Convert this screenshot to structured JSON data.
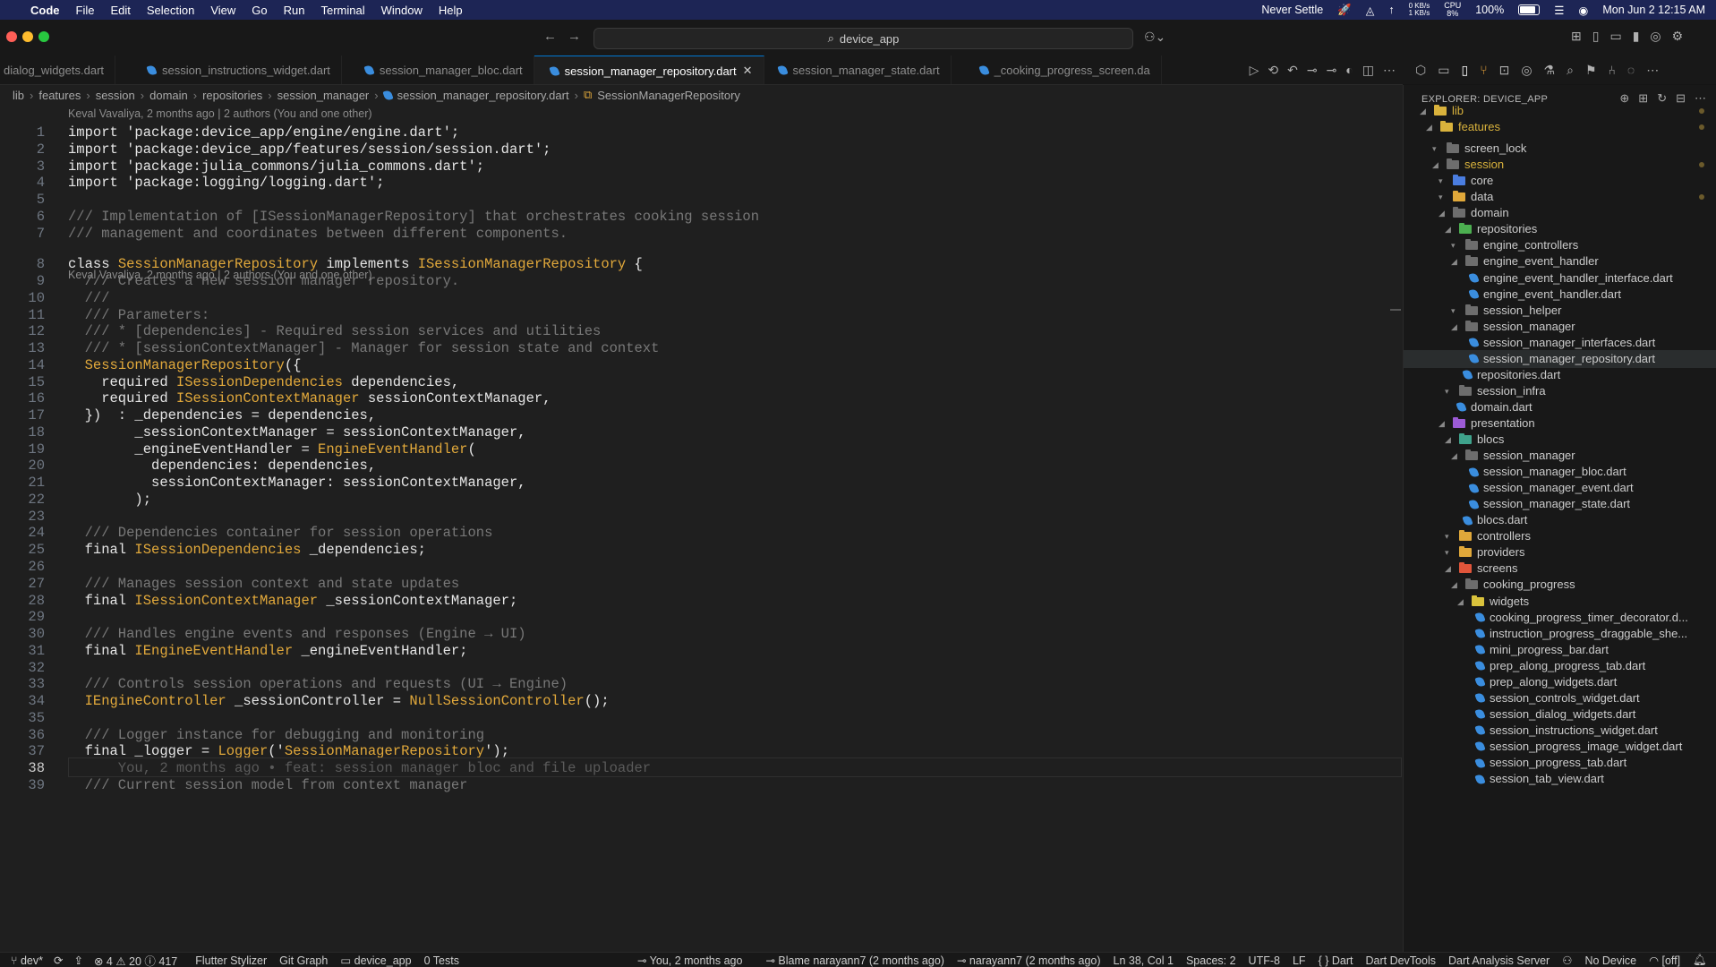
{
  "menubar": {
    "app": "Code",
    "items": [
      "File",
      "Edit",
      "Selection",
      "View",
      "Go",
      "Run",
      "Terminal",
      "Window",
      "Help"
    ],
    "never_settle": "Never Settle",
    "net_up": "0 KB/s",
    "net_down": "1 KB/s",
    "cpu_label": "CPU",
    "cpu_value": "8%",
    "battery": "100%",
    "datetime": "Mon Jun 2  12:15 AM"
  },
  "titlebar": {
    "search": "device_app"
  },
  "tabs": [
    {
      "label": "dialog_widgets.dart",
      "active": false
    },
    {
      "label": "session_instructions_widget.dart",
      "active": false
    },
    {
      "label": "session_manager_bloc.dart",
      "active": false
    },
    {
      "label": "session_manager_repository.dart",
      "active": true
    },
    {
      "label": "session_manager_state.dart",
      "active": false
    },
    {
      "label": "_cooking_progress_screen.da",
      "active": false
    }
  ],
  "breadcrumb": [
    "lib",
    "features",
    "session",
    "domain",
    "repositories",
    "session_manager",
    "session_manager_repository.dart",
    "SessionManagerRepository"
  ],
  "blame": {
    "top": "Keval Vavaliya, 2 months ago | 2 authors (You and one other)",
    "class": "Keval Vavaliya, 2 months ago | 2 authors (You and one other)"
  },
  "code_lines": [
    {
      "n": "1",
      "t": "import 'package:device_app/engine/engine.dart';"
    },
    {
      "n": "2",
      "t": "import 'package:device_app/features/session/session.dart';"
    },
    {
      "n": "3",
      "t": "import 'package:julia_commons/julia_commons.dart';"
    },
    {
      "n": "4",
      "t": "import 'package:logging/logging.dart';"
    },
    {
      "n": "5",
      "t": ""
    },
    {
      "n": "6",
      "t": "/// Implementation of [ISessionManagerRepository] that orchestrates cooking session"
    },
    {
      "n": "7",
      "t": "/// management and coordinates between different components."
    },
    {
      "n": "8",
      "t": "class SessionManagerRepository implements ISessionManagerRepository {"
    },
    {
      "n": "9",
      "t": "  /// Creates a new session manager repository."
    },
    {
      "n": "10",
      "t": "  ///"
    },
    {
      "n": "11",
      "t": "  /// Parameters:"
    },
    {
      "n": "12",
      "t": "  /// * [dependencies] - Required session services and utilities"
    },
    {
      "n": "13",
      "t": "  /// * [sessionContextManager] - Manager for session state and context"
    },
    {
      "n": "14",
      "t": "  SessionManagerRepository({"
    },
    {
      "n": "15",
      "t": "    required ISessionDependencies dependencies,"
    },
    {
      "n": "16",
      "t": "    required ISessionContextManager sessionContextManager,"
    },
    {
      "n": "17",
      "t": "  })  : _dependencies = dependencies,"
    },
    {
      "n": "18",
      "t": "        _sessionContextManager = sessionContextManager,"
    },
    {
      "n": "19",
      "t": "        _engineEventHandler = EngineEventHandler("
    },
    {
      "n": "20",
      "t": "          dependencies: dependencies,"
    },
    {
      "n": "21",
      "t": "          sessionContextManager: sessionContextManager,"
    },
    {
      "n": "22",
      "t": "        );"
    },
    {
      "n": "23",
      "t": ""
    },
    {
      "n": "24",
      "t": "  /// Dependencies container for session operations"
    },
    {
      "n": "25",
      "t": "  final ISessionDependencies _dependencies;"
    },
    {
      "n": "26",
      "t": ""
    },
    {
      "n": "27",
      "t": "  /// Manages session context and state updates"
    },
    {
      "n": "28",
      "t": "  final ISessionContextManager _sessionContextManager;"
    },
    {
      "n": "29",
      "t": ""
    },
    {
      "n": "30",
      "t": "  /// Handles engine events and responses (Engine → UI)"
    },
    {
      "n": "31",
      "t": "  final IEngineEventHandler _engineEventHandler;"
    },
    {
      "n": "32",
      "t": ""
    },
    {
      "n": "33",
      "t": "  /// Controls session operations and requests (UI → Engine)"
    },
    {
      "n": "34",
      "t": "  IEngineController _sessionController = NullSessionController();"
    },
    {
      "n": "35",
      "t": ""
    },
    {
      "n": "36",
      "t": "  /// Logger instance for debugging and monitoring"
    },
    {
      "n": "37",
      "t": "  final _logger = Logger('SessionManagerRepository');"
    },
    {
      "n": "38",
      "t": "      You, 2 months ago • feat: session manager bloc and file uploader"
    },
    {
      "n": "39",
      "t": "  /// Current session model from context manager"
    }
  ],
  "explorer": {
    "title": "EXPLORER: DEVICE_APP",
    "items": [
      {
        "label": "lib",
        "depth": 0,
        "color": "#d9b23c"
      },
      {
        "label": "features",
        "depth": 1,
        "color": "#d9b23c"
      },
      {
        "label": "screen_lock",
        "depth": 2,
        "color": "#6d6d6d"
      },
      {
        "label": "session",
        "depth": 2,
        "color": "#6d6d6d"
      },
      {
        "label": "core",
        "depth": 3,
        "color": "#4a7de0"
      },
      {
        "label": "data",
        "depth": 3,
        "color": "#e0a83a"
      },
      {
        "label": "domain",
        "depth": 3,
        "color": "#6d6d6d"
      },
      {
        "label": "repositories",
        "depth": 4,
        "color": "#4caf50"
      },
      {
        "label": "engine_controllers",
        "depth": 5,
        "color": "#6d6d6d"
      },
      {
        "label": "engine_event_handler",
        "depth": 5,
        "color": "#6d6d6d"
      },
      {
        "label": "engine_event_handler_interface.dart",
        "depth": 6,
        "color": "file"
      },
      {
        "label": "engine_event_handler.dart",
        "depth": 6,
        "color": "file"
      },
      {
        "label": "session_helper",
        "depth": 5,
        "color": "#6d6d6d"
      },
      {
        "label": "session_manager",
        "depth": 5,
        "color": "#6d6d6d"
      },
      {
        "label": "session_manager_interfaces.dart",
        "depth": 6,
        "color": "file"
      },
      {
        "label": "session_manager_repository.dart",
        "depth": 6,
        "color": "file"
      },
      {
        "label": "repositories.dart",
        "depth": 5,
        "color": "file"
      },
      {
        "label": "session_infra",
        "depth": 4,
        "color": "#6d6d6d"
      },
      {
        "label": "domain.dart",
        "depth": 4,
        "color": "file"
      },
      {
        "label": "presentation",
        "depth": 3,
        "color": "#9c5bd6"
      },
      {
        "label": "blocs",
        "depth": 4,
        "color": "#3fa38c"
      },
      {
        "label": "session_manager",
        "depth": 5,
        "color": "#6d6d6d"
      },
      {
        "label": "session_manager_bloc.dart",
        "depth": 6,
        "color": "file"
      },
      {
        "label": "session_manager_event.dart",
        "depth": 6,
        "color": "file"
      },
      {
        "label": "session_manager_state.dart",
        "depth": 6,
        "color": "file"
      },
      {
        "label": "blocs.dart",
        "depth": 5,
        "color": "file"
      },
      {
        "label": "controllers",
        "depth": 4,
        "color": "#e0a83a"
      },
      {
        "label": "providers",
        "depth": 4,
        "color": "#e0a83a"
      },
      {
        "label": "screens",
        "depth": 4,
        "color": "#e0553a"
      },
      {
        "label": "cooking_progress",
        "depth": 5,
        "color": "#6d6d6d"
      },
      {
        "label": "widgets",
        "depth": 6,
        "color": "#d9c23c"
      },
      {
        "label": "cooking_progress_timer_decorator.d...",
        "depth": 7,
        "color": "file"
      },
      {
        "label": "instruction_progress_draggable_she...",
        "depth": 7,
        "color": "file"
      },
      {
        "label": "mini_progress_bar.dart",
        "depth": 7,
        "color": "file"
      },
      {
        "label": "prep_along_progress_tab.dart",
        "depth": 7,
        "color": "file"
      },
      {
        "label": "prep_along_widgets.dart",
        "depth": 7,
        "color": "file"
      },
      {
        "label": "session_controls_widget.dart",
        "depth": 7,
        "color": "file"
      },
      {
        "label": "session_dialog_widgets.dart",
        "depth": 7,
        "color": "file"
      },
      {
        "label": "session_instructions_widget.dart",
        "depth": 7,
        "color": "file"
      },
      {
        "label": "session_progress_image_widget.dart",
        "depth": 7,
        "color": "file"
      },
      {
        "label": "session_progress_tab.dart",
        "depth": 7,
        "color": "file"
      },
      {
        "label": "session_tab_view.dart",
        "depth": 7,
        "color": "file"
      }
    ]
  },
  "statusbar": {
    "branch": "dev*",
    "problems": "⊗ 4 ⚠ 20 ⓘ 417",
    "flutter_stylizer": "Flutter Stylizer",
    "git_graph": "Git Graph",
    "folder": "device_app",
    "tests": "0 Tests",
    "blame_you": "You, 2 months ago",
    "blame_narayann": "Blame narayann7 (2 months ago)",
    "narayann": "narayann7 (2 months ago)",
    "position": "Ln 38, Col 1",
    "spaces": "Spaces: 2",
    "encoding": "UTF-8",
    "eol": "LF",
    "language": "{ } Dart",
    "devtools": "Dart DevTools",
    "analysis": "Dart Analysis Server",
    "device": "No Device",
    "off": "[off]"
  }
}
